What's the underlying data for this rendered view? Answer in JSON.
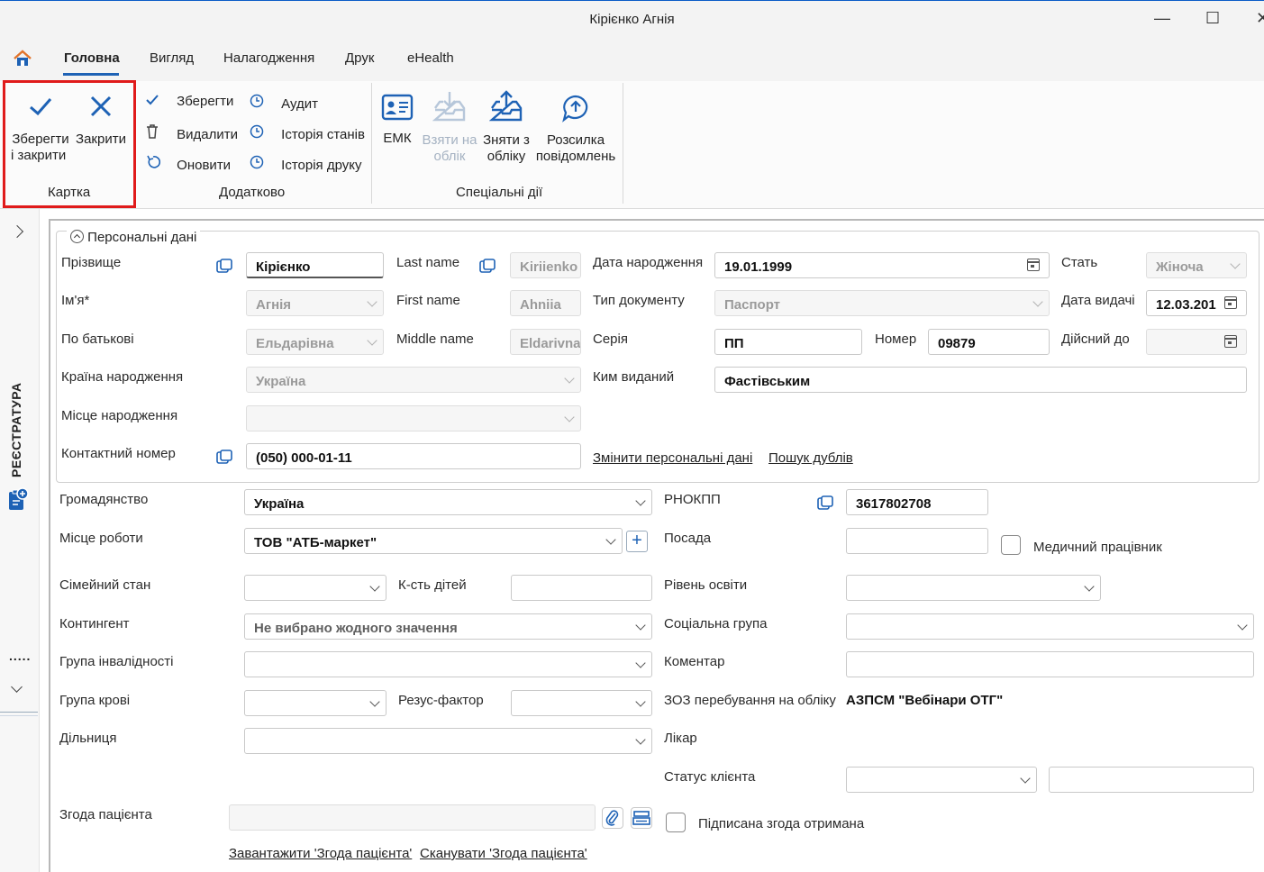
{
  "window": {
    "title": "Кірієнко Агнія",
    "minimize": "—",
    "maximize": "☐",
    "close": "✕"
  },
  "menu": {
    "tabs": [
      "Головна",
      "Вигляд",
      "Налагодження",
      "Друк",
      "eHealth"
    ],
    "active_tab": "Головна"
  },
  "ribbon": {
    "card_group": {
      "label": "Картка",
      "save_close_line1": "Зберегти",
      "save_close_line2": "і закрити",
      "close": "Закрити"
    },
    "extra_group": {
      "label": "Додатково",
      "save": "Зберегти",
      "delete": "Видалити",
      "refresh": "Оновити",
      "audit": "Аудит",
      "state_history": "Історія станів",
      "print_history": "Історія друку"
    },
    "special_group": {
      "label": "Спеціальні дії",
      "emk": "ЕМК",
      "take_line1": "Взяти на",
      "take_line2": "облік",
      "remove_line1": "Зняти з",
      "remove_line2": "обліку",
      "mailing_line1": "Розсилка",
      "mailing_line2": "повідомлень"
    }
  },
  "rail": {
    "label": "РЕЄСТРАТУРА",
    "dots": "....."
  },
  "personal": {
    "legend": "Персональні дані",
    "surname_label": "Прізвище",
    "surname": "Кірієнко",
    "lastname_label": "Last name",
    "lastname": "Kiriienko",
    "birthdate_label": "Дата народження",
    "birthdate": "19.01.1999",
    "sex_label": "Стать",
    "sex": "Жіноча",
    "name_label": "Ім'я*",
    "name": "Агнія",
    "firstname_label": "First name",
    "firstname": "Ahniia",
    "doctype_label": "Тип документу",
    "doctype": "Паспорт",
    "issue_date_label": "Дата видачі",
    "issue_date": "12.03.201",
    "patronymic_label": "По батькові",
    "patronymic": "Ельдарівна",
    "middlename_label": "Middle name",
    "middlename": "Eldarivna",
    "series_label": "Серія",
    "series": "ПП",
    "number_label": "Номер",
    "number": "09879",
    "valid_until_label": "Дійсний до",
    "valid_until": "",
    "birth_country_label": "Країна народження",
    "birth_country": "Україна",
    "issued_by_label": "Ким виданий",
    "issued_by": "Фастівським",
    "birth_place_label": "Місце народження",
    "birth_place": "",
    "phone_label": "Контактний номер",
    "phone": "(050) 000-01-11",
    "change_link": "Змінити персональні дані",
    "dup_link": "Пошук дублів"
  },
  "extra": {
    "citizenship_label": "Громадянство",
    "citizenship": "Україна",
    "rnokpp_label": "РНОКПП",
    "rnokpp": "3617802708",
    "work_label": "Місце роботи",
    "work": "ТОВ \"АТБ-маркет\"",
    "position_label": "Посада",
    "position": "",
    "medical_worker_label": "Медичний працівник",
    "marital_label": "Сімейний стан",
    "marital": "",
    "children_label": "К-сть дітей",
    "children": "",
    "education_label": "Рівень освіти",
    "education": "",
    "contingent_label": "Контингент",
    "contingent": "Не вибрано жодного значення",
    "social_label": "Соціальна група",
    "social": "",
    "disability_label": "Група інвалідності",
    "disability": "",
    "comment_label": "Коментар",
    "comment": "",
    "blood_label": "Група крові",
    "blood": "",
    "rhesus_label": "Резус-фактор",
    "rhesus": "",
    "zoz_label": "ЗОЗ перебування на обліку",
    "zoz": "АЗПСМ \"Вебінари ОТГ\"",
    "district_label": "Дільниця",
    "district": "",
    "doctor_label": "Лікар",
    "client_status_label": "Статус клієнта",
    "consent_label": "Згода пацієнта",
    "consent_signed_label": "Підписана згода отримана",
    "upload_link": "Завантажити 'Згода пацієнта'",
    "scan_link": "Сканувати 'Згода пацієнта'"
  },
  "colors": {
    "accent": "#1e62b5",
    "highlight_box": "#e01b1b"
  }
}
